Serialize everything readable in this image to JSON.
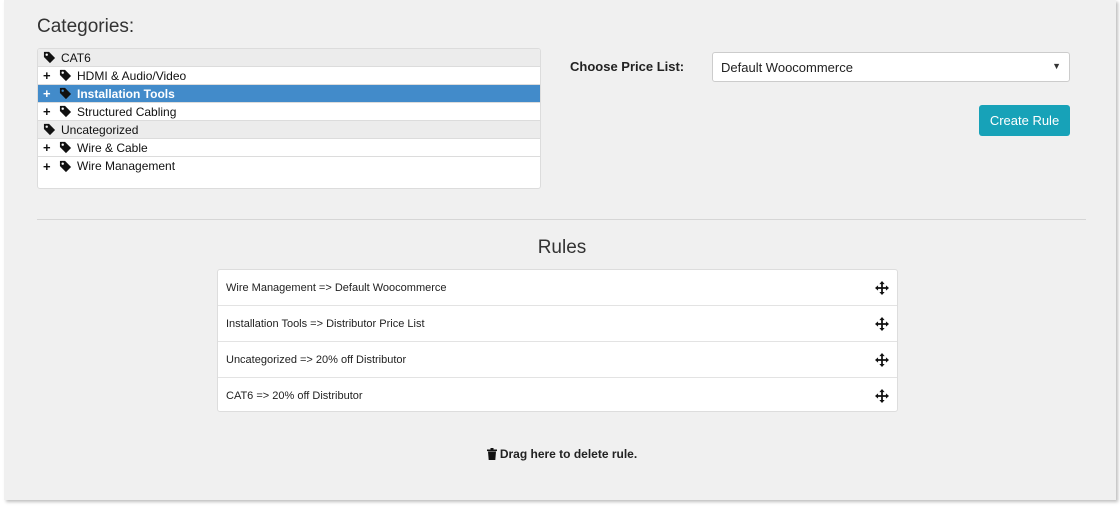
{
  "categories": {
    "heading": "Categories:",
    "items": [
      {
        "label": "CAT6",
        "expandable": false,
        "style": "shaded"
      },
      {
        "label": "HDMI & Audio/Video",
        "expandable": true,
        "style": "normal"
      },
      {
        "label": "Installation Tools",
        "expandable": true,
        "style": "selected"
      },
      {
        "label": "Structured Cabling",
        "expandable": true,
        "style": "normal"
      },
      {
        "label": "Uncategorized",
        "expandable": false,
        "style": "shaded"
      },
      {
        "label": "Wire & Cable",
        "expandable": true,
        "style": "normal"
      },
      {
        "label": "Wire Management",
        "expandable": true,
        "style": "normal"
      }
    ]
  },
  "price_list": {
    "label": "Choose Price List:",
    "selected": "Default Woocommerce"
  },
  "create_button": "Create Rule",
  "rules": {
    "heading": "Rules",
    "items": [
      "Wire Management => Default Woocommerce",
      "Installation Tools => Distributor Price List",
      "Uncategorized => 20% off Distributor",
      "CAT6 => 20% off Distributor"
    ]
  },
  "delete_zone": "Drag here to delete rule.",
  "colors": {
    "selected": "#428bca",
    "button": "#17a2b8",
    "panel": "#f0f0f0"
  },
  "icons": {
    "tag": "tag-icon",
    "plus": "plus-icon",
    "move": "move-icon",
    "trash": "trash-icon"
  }
}
